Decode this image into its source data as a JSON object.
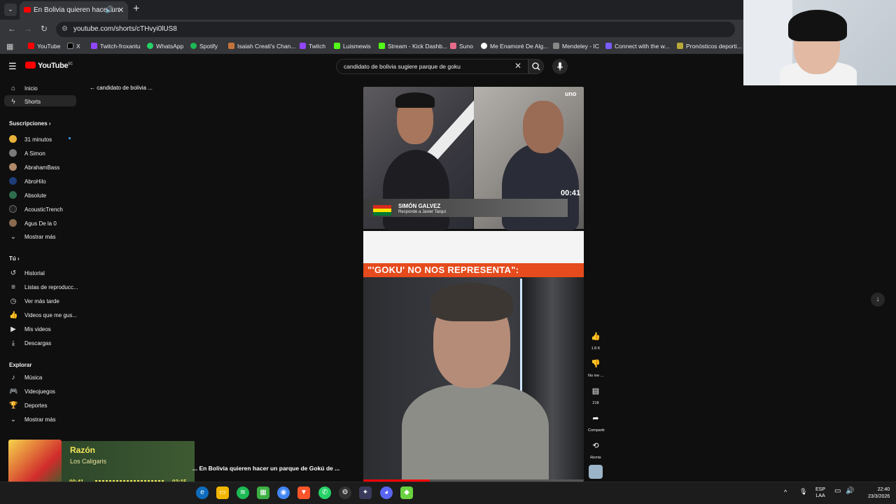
{
  "browser": {
    "tab_title": "En Bolivia quieren hacer un",
    "url": "youtube.com/shorts/cTHvyi0lUS8",
    "bookmarks": [
      "YouTube",
      "X",
      "Twitch-froxantu",
      "WhatsApp",
      "Spotify",
      "Isaiah Creati's Chan...",
      "Twitch",
      "Luismewis",
      "Stream - Kick Dashb...",
      "Suno",
      "Me Enamoré De Alg...",
      "Mendeley - IC",
      "Connect with the w...",
      "Pronósticos deporti..."
    ]
  },
  "youtube": {
    "logo": "YouTube",
    "country": "EC",
    "search_value": "candidato de bolivia sugiere parque de goku",
    "back_label": "candidato de bolivia ...",
    "sidebar": {
      "main": [
        "Inicio",
        "Shorts"
      ],
      "subs_title": "Suscripciones",
      "subs": [
        "31 minutos",
        "A Simon",
        "AbrahamBass",
        "AbroHilo",
        "Absolute",
        "AcousticTrench",
        "Agus De la 0"
      ],
      "subs_more": "Mostrar más",
      "you_title": "Tú",
      "you": [
        "Historial",
        "Listas de reproducc...",
        "Ver más tarde",
        "Videos que me gus...",
        "Mis videos",
        "Descargas"
      ],
      "explore_title": "Explorar",
      "explore": [
        "Música",
        "Videojuegos",
        "Deportes"
      ],
      "explore_more": "Mostrar más"
    },
    "video": {
      "lower_third_name": "SIMÓN GALVEZ",
      "lower_third_sub": "Responde a Javier Tarqui",
      "timer": "00:41",
      "channel_bug": "uno",
      "banner": "\"'GOKU' NO NOS REPRESENTA\":",
      "caption": "... En Bolivia quieren hacer un parque de Gokú de ..."
    },
    "actions": {
      "likes": "1.8 K",
      "dislike": "No me ...",
      "comments": "218",
      "share": "Compartir",
      "remix": "Remix"
    }
  },
  "now_playing": {
    "title": "Razón",
    "artist": "Los Caligaris",
    "current": "00:41",
    "duration": "03:15"
  },
  "taskbar": {
    "lang": "ESP",
    "lang2": "LAA",
    "time": "22:40",
    "date": "23/3/2026"
  }
}
